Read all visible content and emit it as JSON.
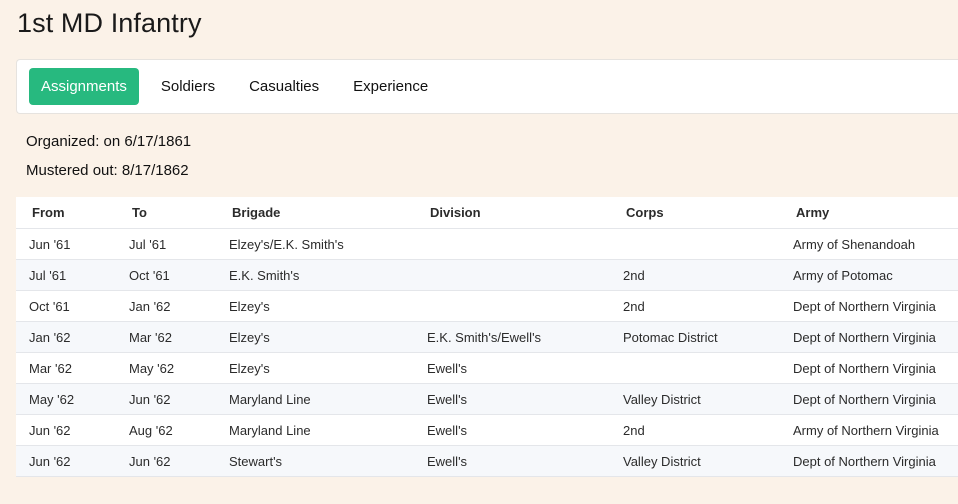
{
  "page": {
    "title": "1st MD Infantry"
  },
  "tabs": [
    {
      "label": "Assignments",
      "active": true
    },
    {
      "label": "Soldiers",
      "active": false
    },
    {
      "label": "Casualties",
      "active": false
    },
    {
      "label": "Experience",
      "active": false
    }
  ],
  "info": {
    "organized": "Organized: on 6/17/1861",
    "mustered_out": "Mustered out: 8/17/1862"
  },
  "table": {
    "headers": [
      "From",
      "To",
      "Brigade",
      "Division",
      "Corps",
      "Army"
    ],
    "rows": [
      [
        "Jun '61",
        "Jul '61",
        "Elzey's/E.K. Smith's",
        "",
        "",
        "Army of Shenandoah"
      ],
      [
        "Jul '61",
        "Oct '61",
        "E.K. Smith's",
        "",
        "2nd",
        "Army of Potomac"
      ],
      [
        "Oct '61",
        "Jan '62",
        "Elzey's",
        "",
        "2nd",
        "Dept of Northern Virginia"
      ],
      [
        "Jan '62",
        "Mar '62",
        "Elzey's",
        "E.K. Smith's/Ewell's",
        "Potomac District",
        "Dept of Northern Virginia"
      ],
      [
        "Mar '62",
        "May '62",
        "Elzey's",
        "Ewell's",
        "",
        "Dept of Northern Virginia"
      ],
      [
        "May '62",
        "Jun '62",
        "Maryland Line",
        "Ewell's",
        "Valley District",
        "Dept of Northern Virginia"
      ],
      [
        "Jun '62",
        "Aug '62",
        "Maryland Line",
        "Ewell's",
        "2nd",
        "Army of Northern Virginia"
      ],
      [
        "Jun '62",
        "Jun '62",
        "Stewart's",
        "Ewell's",
        "Valley District",
        "Dept of Northern Virginia"
      ]
    ]
  },
  "colors": {
    "background": "#fbf2e8",
    "accent": "#27b97f",
    "row_stripe": "#f6f8fb"
  }
}
